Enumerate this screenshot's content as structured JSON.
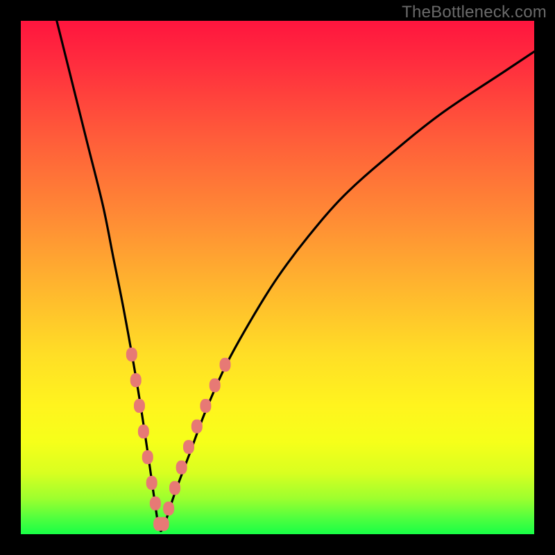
{
  "watermark": "TheBottleneck.com",
  "colors": {
    "frame": "#000000",
    "curve": "#000000",
    "markers": "#e77975",
    "gradient_top": "#ff153e",
    "gradient_bottom": "#18ff46"
  },
  "chart_data": {
    "type": "line",
    "title": "",
    "xlabel": "",
    "ylabel": "",
    "xlim": [
      0,
      100
    ],
    "ylim": [
      0,
      100
    ],
    "grid": false,
    "legend": false,
    "annotations": [
      "TheBottleneck.com"
    ],
    "series": [
      {
        "name": "bottleneck-curve",
        "x": [
          7,
          10,
          13,
          16,
          18,
          20,
          22,
          23.5,
          25,
          26,
          27,
          28,
          30,
          33,
          36,
          40,
          45,
          50,
          56,
          63,
          72,
          82,
          94,
          100
        ],
        "y": [
          100,
          88,
          76,
          64,
          54,
          44,
          33,
          24,
          14,
          7,
          1,
          2,
          8,
          16,
          24,
          33,
          42,
          50,
          58,
          66,
          74,
          82,
          90,
          94
        ]
      }
    ],
    "markers": {
      "name": "highlighted-points",
      "shape": "rounded-rect",
      "color": "#e77975",
      "points": [
        {
          "x": 21.6,
          "y": 35
        },
        {
          "x": 22.4,
          "y": 30
        },
        {
          "x": 23.1,
          "y": 25
        },
        {
          "x": 23.9,
          "y": 20
        },
        {
          "x": 24.7,
          "y": 15
        },
        {
          "x": 25.5,
          "y": 10
        },
        {
          "x": 26.2,
          "y": 6
        },
        {
          "x": 26.9,
          "y": 2
        },
        {
          "x": 27.8,
          "y": 2
        },
        {
          "x": 28.8,
          "y": 5
        },
        {
          "x": 30.0,
          "y": 9
        },
        {
          "x": 31.3,
          "y": 13
        },
        {
          "x": 32.7,
          "y": 17
        },
        {
          "x": 34.3,
          "y": 21
        },
        {
          "x": 36.0,
          "y": 25
        },
        {
          "x": 37.8,
          "y": 29
        },
        {
          "x": 39.8,
          "y": 33
        }
      ]
    }
  }
}
